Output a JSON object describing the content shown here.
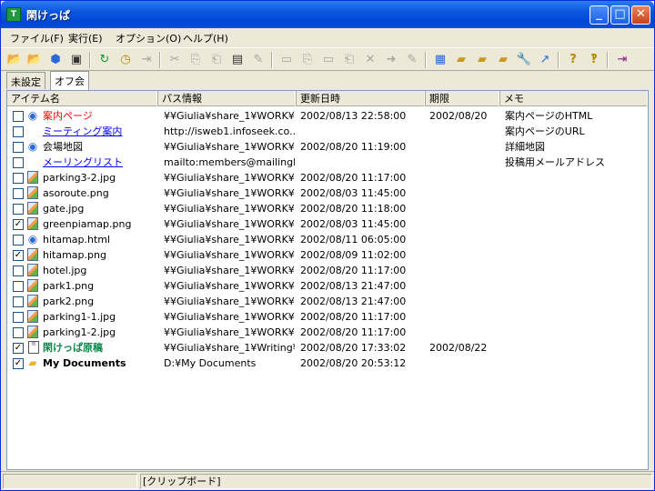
{
  "window": {
    "title": "閑けっぱ"
  },
  "menus": [
    "ファイル(F)",
    "実行(E)",
    "オプション(O)",
    "ヘルプ(H)"
  ],
  "tabs": [
    "未設定",
    "オフ会"
  ],
  "columns": [
    "アイテム名",
    "パス情報",
    "更新日時",
    "期限",
    "メモ"
  ],
  "rows": [
    {
      "checked": false,
      "icon": "web-page-icon",
      "name": "案内ページ",
      "style": "red",
      "path": "¥¥Giulia¥share_1¥WORK¥...",
      "date": "2002/08/13 22:58:00",
      "due": "2002/08/20",
      "memo": "案内ページのHTML"
    },
    {
      "checked": false,
      "icon": "",
      "name": "ミーティング案内",
      "style": "link",
      "path": "http://isweb1.infoseek.co....",
      "date": "",
      "due": "",
      "memo": "案内ページのURL"
    },
    {
      "checked": false,
      "icon": "web-page-icon",
      "name": "会場地図",
      "style": "",
      "path": "¥¥Giulia¥share_1¥WORK¥...",
      "date": "2002/08/20 11:19:00",
      "due": "",
      "memo": "詳細地図"
    },
    {
      "checked": false,
      "icon": "",
      "name": "メーリングリスト",
      "style": "link",
      "path": "mailto:members@mailingli...",
      "date": "",
      "due": "",
      "memo": "投稿用メールアドレス"
    },
    {
      "checked": false,
      "icon": "image-file-icon",
      "name": "parking3-2.jpg",
      "style": "",
      "path": "¥¥Giulia¥share_1¥WORK¥...",
      "date": "2002/08/20 11:17:00",
      "due": "",
      "memo": ""
    },
    {
      "checked": false,
      "icon": "image-file-icon",
      "name": "asoroute.png",
      "style": "",
      "path": "¥¥Giulia¥share_1¥WORK¥...",
      "date": "2002/08/03 11:45:00",
      "due": "",
      "memo": ""
    },
    {
      "checked": false,
      "icon": "image-file-icon",
      "name": "gate.jpg",
      "style": "",
      "path": "¥¥Giulia¥share_1¥WORK¥...",
      "date": "2002/08/20 11:18:00",
      "due": "",
      "memo": ""
    },
    {
      "checked": true,
      "icon": "image-file-icon",
      "name": "greenpiamap.png",
      "style": "",
      "path": "¥¥Giulia¥share_1¥WORK¥...",
      "date": "2002/08/03 11:45:00",
      "due": "",
      "memo": ""
    },
    {
      "checked": false,
      "icon": "web-page-icon",
      "name": "hitamap.html",
      "style": "",
      "path": "¥¥Giulia¥share_1¥WORK¥...",
      "date": "2002/08/11 06:05:00",
      "due": "",
      "memo": ""
    },
    {
      "checked": true,
      "icon": "image-file-icon",
      "name": "hitamap.png",
      "style": "",
      "path": "¥¥Giulia¥share_1¥WORK¥...",
      "date": "2002/08/09 11:02:00",
      "due": "",
      "memo": ""
    },
    {
      "checked": false,
      "icon": "image-file-icon",
      "name": "hotel.jpg",
      "style": "",
      "path": "¥¥Giulia¥share_1¥WORK¥...",
      "date": "2002/08/20 11:17:00",
      "due": "",
      "memo": ""
    },
    {
      "checked": false,
      "icon": "image-file-icon",
      "name": "park1.png",
      "style": "",
      "path": "¥¥Giulia¥share_1¥WORK¥...",
      "date": "2002/08/13 21:47:00",
      "due": "",
      "memo": ""
    },
    {
      "checked": false,
      "icon": "image-file-icon",
      "name": "park2.png",
      "style": "",
      "path": "¥¥Giulia¥share_1¥WORK¥...",
      "date": "2002/08/13 21:47:00",
      "due": "",
      "memo": ""
    },
    {
      "checked": false,
      "icon": "image-file-icon",
      "name": "parking1-1.jpg",
      "style": "",
      "path": "¥¥Giulia¥share_1¥WORK¥...",
      "date": "2002/08/20 11:17:00",
      "due": "",
      "memo": ""
    },
    {
      "checked": false,
      "icon": "image-file-icon",
      "name": "parking1-2.jpg",
      "style": "",
      "path": "¥¥Giulia¥share_1¥WORK¥...",
      "date": "2002/08/20 11:17:00",
      "due": "",
      "memo": ""
    },
    {
      "checked": true,
      "icon": "document-icon",
      "name": "閑けっぱ原稿",
      "style": "green",
      "path": "¥¥Giulia¥share_1¥Writing¥...",
      "date": "2002/08/20 17:33:02",
      "due": "2002/08/22",
      "memo": ""
    },
    {
      "checked": true,
      "icon": "folder-icon",
      "name": "My Documents",
      "style": "bold",
      "path": "D:¥My Documents",
      "date": "2002/08/20 20:53:12",
      "due": "",
      "memo": ""
    }
  ],
  "status": {
    "left": "",
    "clipboard": "[クリップボード]"
  }
}
